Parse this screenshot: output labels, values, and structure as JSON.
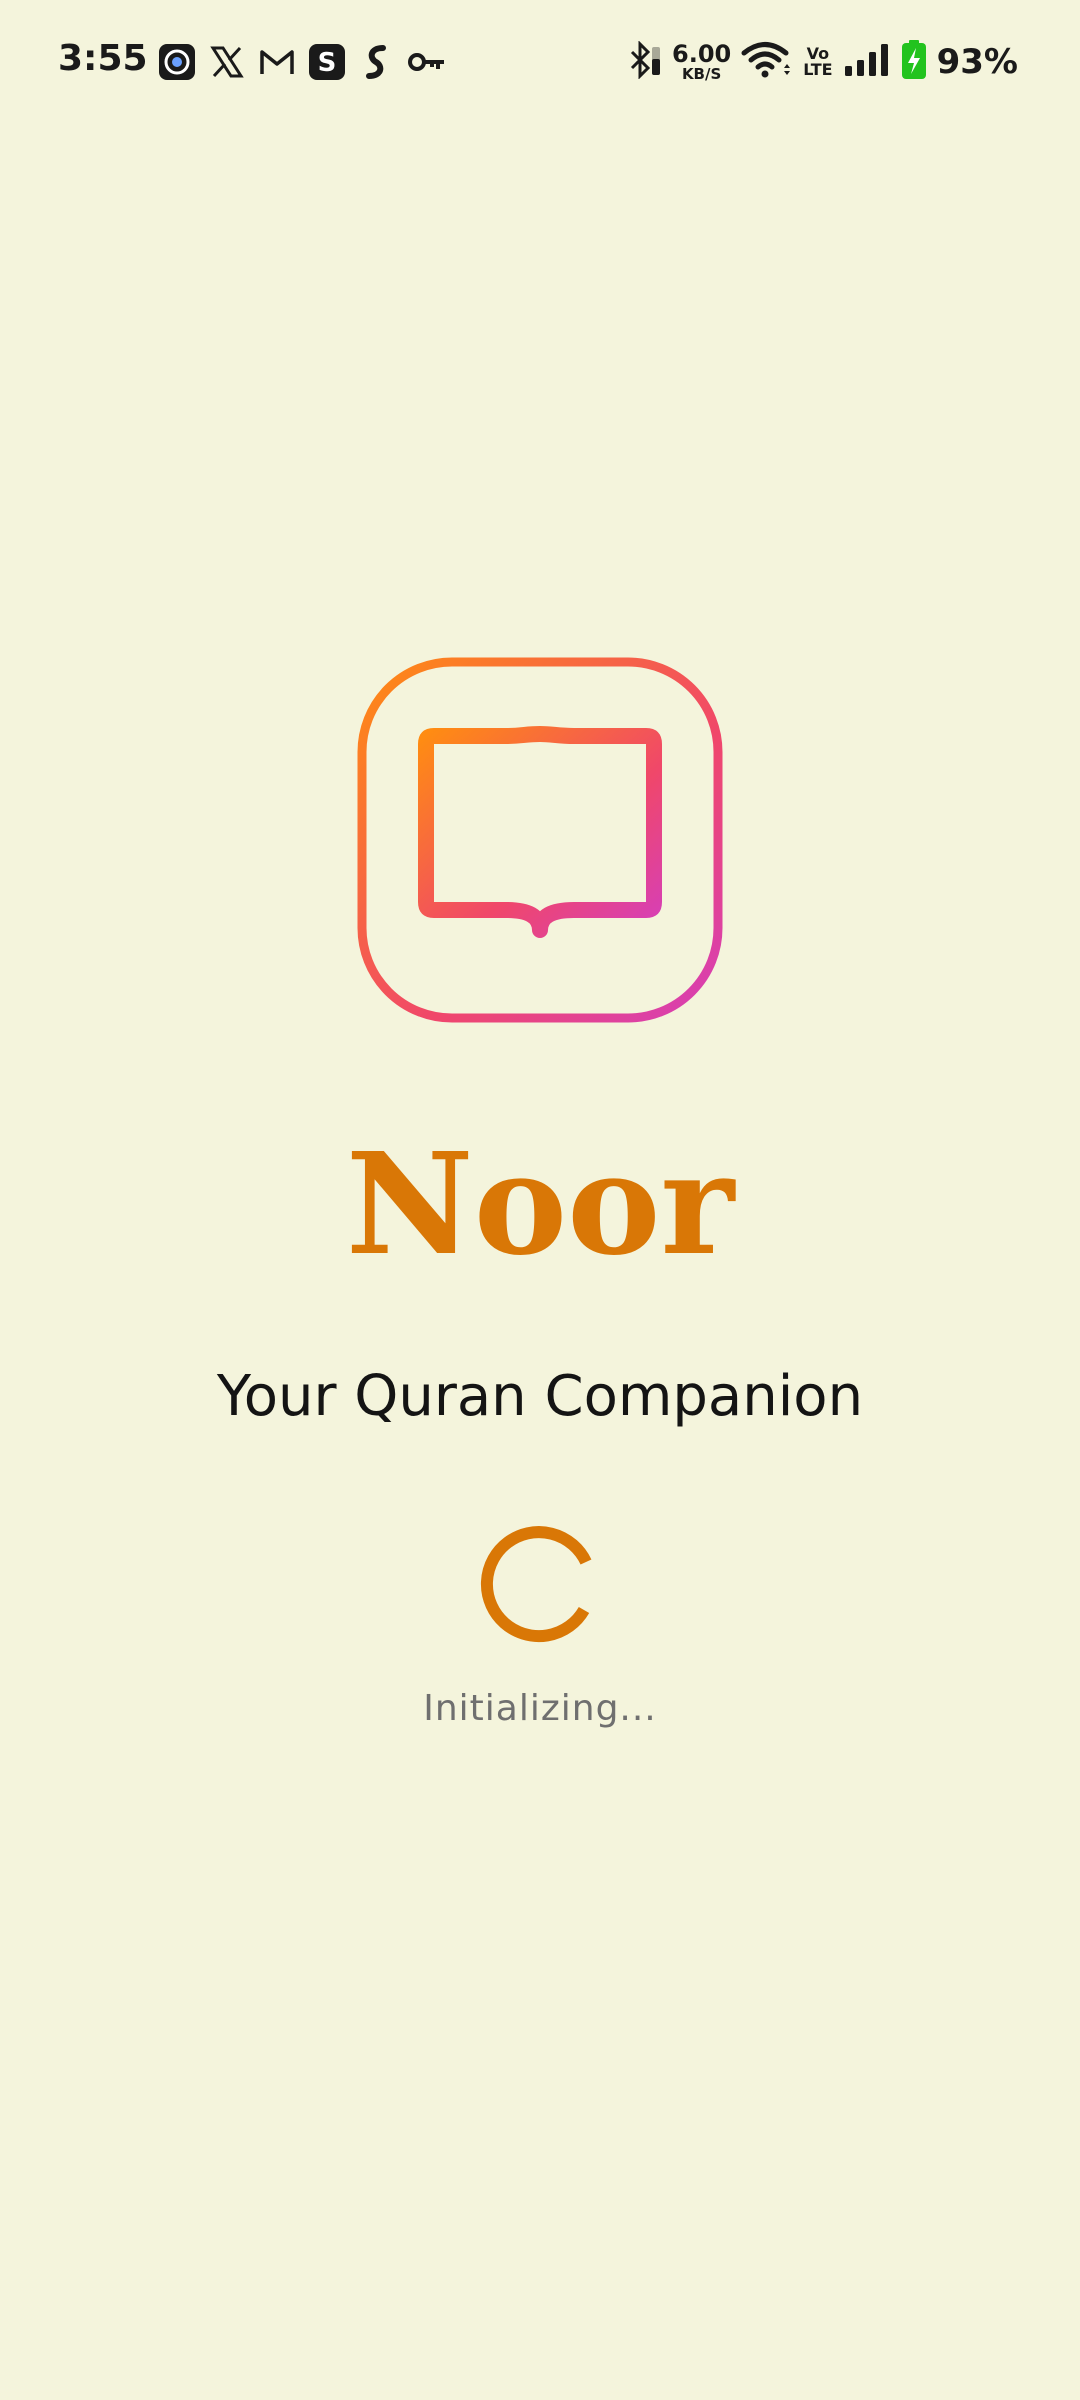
{
  "status_bar": {
    "time": "3:55",
    "notification_icons": [
      "pixel-app-icon",
      "x-icon",
      "gmail-icon",
      "s-app-icon",
      "shazam-like-icon",
      "key-icon"
    ],
    "bluetooth": "bluetooth-icon",
    "net_speed_value": "6.00",
    "net_speed_unit": "KB/S",
    "volte_top": "Vo",
    "volte_bottom": "LTE",
    "battery_percent": "93%"
  },
  "splash": {
    "logo_icon": "open-book-icon",
    "app_name": "Noor",
    "tagline": "Your Quran Companion",
    "loading_text": "Initializing..."
  },
  "colors": {
    "background": "#f4f4dc",
    "brand": "#d97706",
    "logo_gradient_start": "#ff8c12",
    "logo_gradient_mid": "#f0476a",
    "logo_gradient_end": "#d63fb8",
    "battery_green": "#22c31e"
  }
}
